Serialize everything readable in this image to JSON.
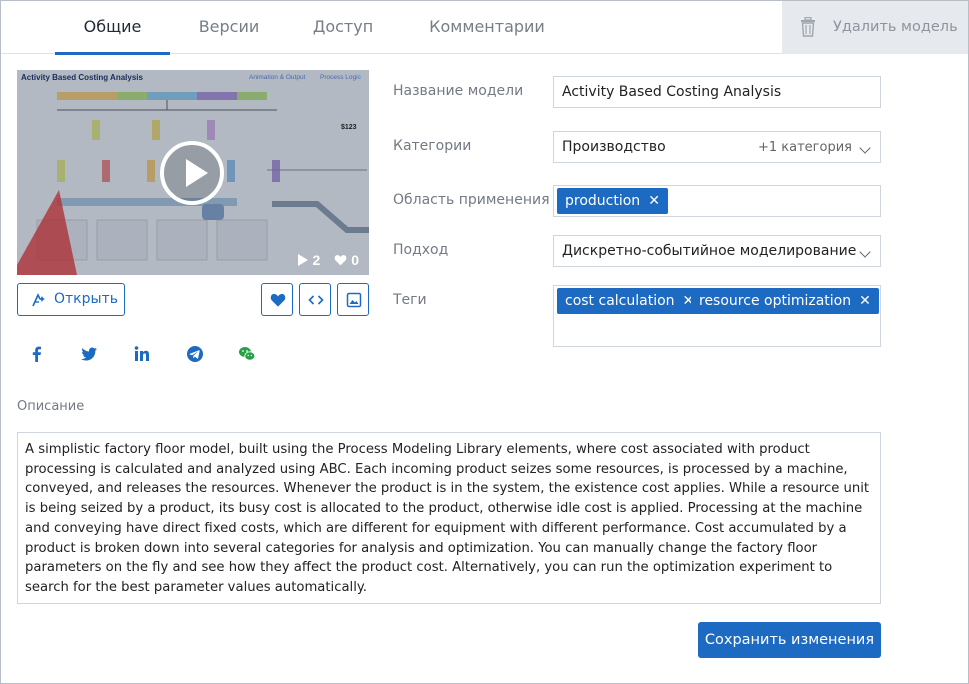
{
  "tabs": [
    {
      "label": "Общие",
      "active": true
    },
    {
      "label": "Версии",
      "active": false
    },
    {
      "label": "Доступ",
      "active": false
    },
    {
      "label": "Комментарии",
      "active": false
    }
  ],
  "delete_button": {
    "label": "Удалить модель",
    "icon": "trash-icon"
  },
  "preview": {
    "title": "Activity Based Costing Analysis",
    "nav": [
      "Animation & Output",
      "Process Logic"
    ],
    "price": "$123",
    "plays": "2",
    "likes": "0"
  },
  "open_button": {
    "label": "Открыть",
    "icon": "open-model-icon"
  },
  "icon_buttons": [
    "heart-icon",
    "embed-code-icon",
    "image-icon"
  ],
  "share_icons": [
    "facebook-icon",
    "twitter-icon",
    "linkedin-icon",
    "telegram-icon",
    "wechat-icon"
  ],
  "form": {
    "name": {
      "label": "Название модели",
      "value": "Activity Based Costing Analysis"
    },
    "categories": {
      "label": "Категории",
      "value": "Производство",
      "extra": "+1 категория"
    },
    "domain": {
      "label": "Область применения",
      "chips": [
        "production"
      ]
    },
    "approach": {
      "label": "Подход",
      "value": "Дискретно-событийное моделирование"
    },
    "tags": {
      "label": "Теги",
      "chips": [
        "cost calculation",
        "resource optimization"
      ]
    }
  },
  "description": {
    "label": "Описание",
    "text": "A simplistic factory floor model, built using the Process Modeling Library elements, where cost associated with product processing is calculated and analyzed using ABC. Each incoming product seizes some resources, is processed by a machine, conveyed, and releases the resources. Whenever the product is in the system, the existence cost applies. While a resource unit is being seized by a product, its busy cost is allocated to the product, otherwise idle cost is applied. Processing at the machine and conveying have direct fixed costs, which are different for equipment with different performance.  Cost accumulated by a product is broken down into several categories for analysis and optimization. You can manually change the factory floor parameters on the fly and see how they affect the product cost. Alternatively, you can run the optimization experiment to search for the best parameter values automatically."
  },
  "save_button": {
    "label": "Сохранить изменения"
  },
  "colors": {
    "accent": "#1c6ac1",
    "tab_inactive": "#777e87",
    "delete_bg": "#e6eaef"
  }
}
